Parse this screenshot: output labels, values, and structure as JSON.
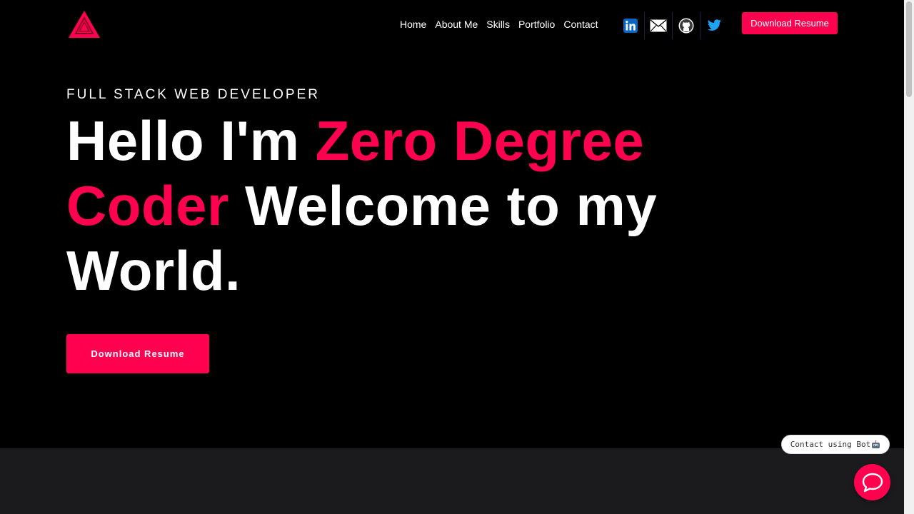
{
  "colors": {
    "accent": "#ff014f",
    "background": "#000000",
    "section_dark": "#1b1b1d",
    "text": "#ffffff"
  },
  "header": {
    "logo_icon": "triangle-logo-icon",
    "nav": [
      {
        "label": "Home"
      },
      {
        "label": "About Me"
      },
      {
        "label": "Skills"
      },
      {
        "label": "Portfolio"
      },
      {
        "label": "Contact"
      }
    ],
    "socials": [
      {
        "icon": "linkedin-icon"
      },
      {
        "icon": "mail-icon"
      },
      {
        "icon": "github-icon"
      },
      {
        "icon": "twitter-icon"
      }
    ],
    "resume_button": "Download Resume"
  },
  "hero": {
    "subtitle": "FULL STACK WEB DEVELOPER",
    "headline_part1": "Hello I'm ",
    "headline_accent": "Zero Degree Coder",
    "headline_part2": " Welcome to my World.",
    "cta_button": "Download Resume"
  },
  "bot": {
    "bubble_text": "Contact using Bot",
    "bubble_icon": "robot-icon",
    "fab_icon": "chat-bubble-icon"
  }
}
